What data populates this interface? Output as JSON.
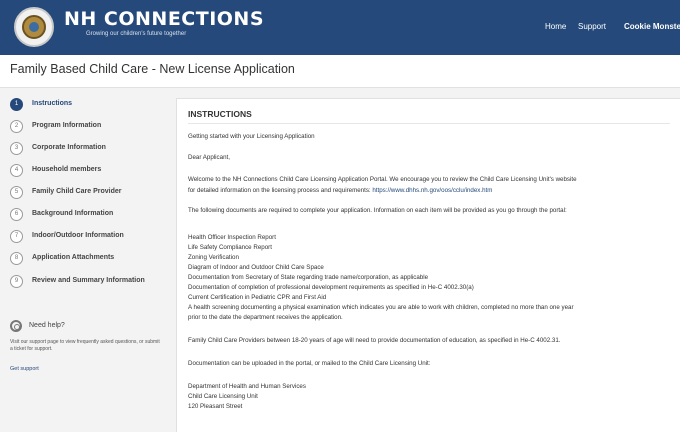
{
  "header": {
    "brand_title": "NH CONNECTIONS",
    "brand_tagline": "Growing our children's future together",
    "nav": {
      "home": "Home",
      "support": "Support",
      "user": "Cookie Monster"
    },
    "colors": {
      "header_bg": "#24497a",
      "link": "#24497a"
    }
  },
  "page": {
    "title": "Family Based Child Care - New License Application"
  },
  "steps": [
    {
      "number": "1",
      "label": "Instructions",
      "active": true
    },
    {
      "number": "2",
      "label": "Program Information"
    },
    {
      "number": "3",
      "label": "Corporate Information"
    },
    {
      "number": "4",
      "label": "Household members"
    },
    {
      "number": "5",
      "label": "Family Child Care Provider"
    },
    {
      "number": "6",
      "label": "Background Information"
    },
    {
      "number": "7",
      "label": "Indoor/Outdoor Information"
    },
    {
      "number": "8",
      "label": "Application Attachments"
    },
    {
      "number": "9",
      "label": "Review and Summary Information"
    }
  ],
  "help": {
    "title": "Need help?",
    "text": "Visit our support page to view frequently asked questions, or submit a ticket for support.",
    "link": "Get support"
  },
  "main": {
    "heading": "INSTRUCTIONS",
    "getting_started": "Getting started with your Licensing Application",
    "salutation": "Dear Applicant,",
    "welcome_line1": "Welcome to the NH Connections Child Care Licensing Application Portal. We encourage you to review the Child Care Licensing Unit's website",
    "welcome_line2_prefix": "for detailed information on the licensing process and requirements: ",
    "welcome_link": "https://www.dhhs.nh.gov/oos/cclu/index.htm",
    "documents_intro": "The following documents are required to complete your application. Information on each item will be provided as you go through the portal:",
    "documents": [
      "Health Officer Inspection Report",
      "Life Safety Compliance Report",
      "Zoning Verification",
      "Diagram of Indoor and Outdoor Child Care Space",
      "Documentation from Secretary of State regarding trade name/corporation, as applicable",
      "Documentation of completion of professional development requirements as specified in He-C 4002.30(a)",
      "Current Certification in Pediatric CPR and First Aid",
      "A health screening documenting a physical examination which indicates you are able to work with children, completed no more than one year",
      "prior to the date the department receives the application."
    ],
    "providers_note": "Family Child Care Providers between 18-20 years of age will need to provide documentation of education, as specified in He-C 4002.31.",
    "upload_note": "Documentation can be uploaded in the portal, or mailed to the Child Care Licensing Unit:",
    "address": [
      "Department of Health and Human Services",
      "Child Care Licensing Unit",
      "120 Pleasant Street"
    ]
  }
}
